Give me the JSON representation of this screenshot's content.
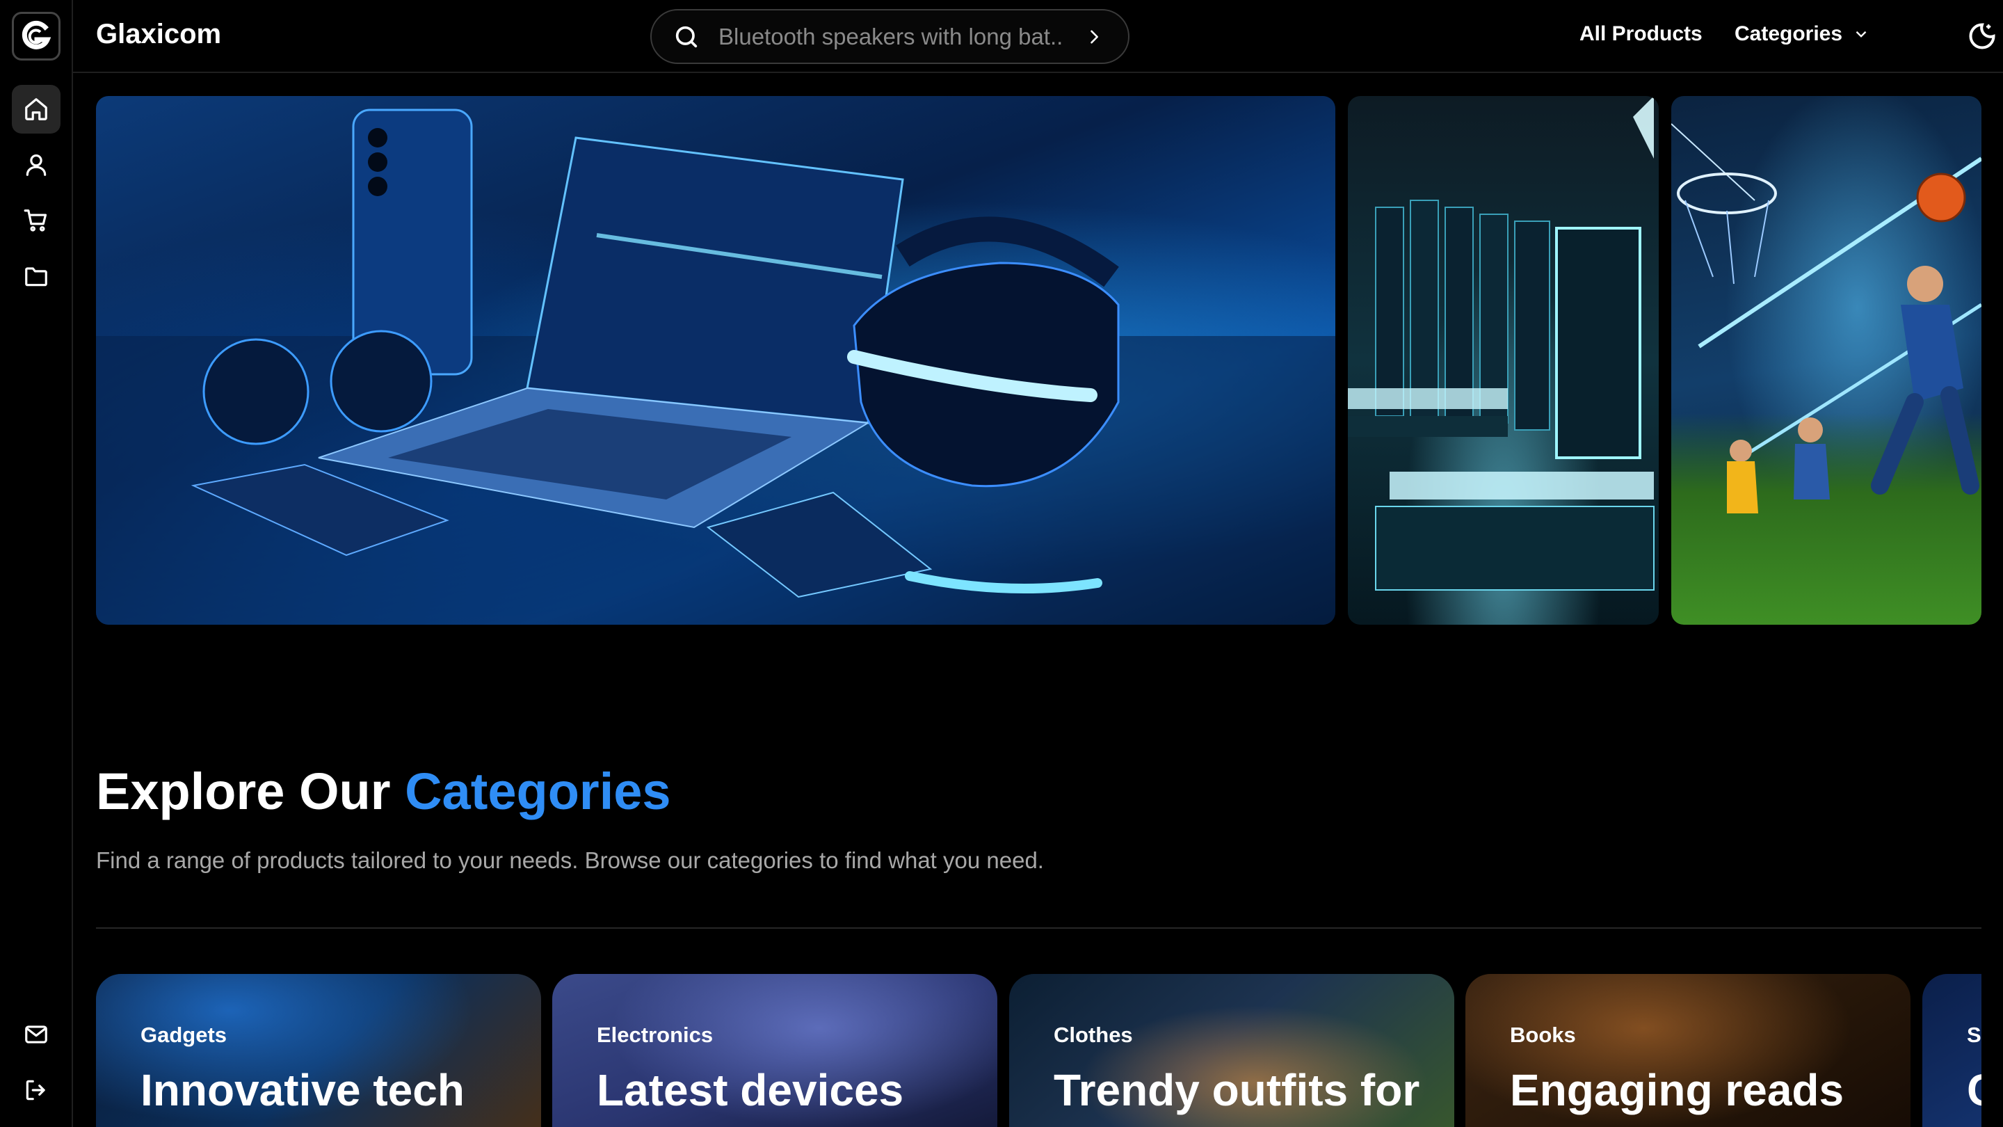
{
  "app": {
    "brand": "Glaxicom"
  },
  "search": {
    "placeholder": "Bluetooth speakers with long bat.."
  },
  "nav": {
    "all_products": "All Products",
    "categories": "Categories"
  },
  "sidebar": {
    "items": [
      {
        "name": "home",
        "icon": "home-icon",
        "active": true
      },
      {
        "name": "profile",
        "icon": "user-icon",
        "active": false
      },
      {
        "name": "cart",
        "icon": "cart-icon",
        "active": false
      },
      {
        "name": "files",
        "icon": "folder-icon",
        "active": false
      }
    ],
    "bottom": [
      {
        "name": "mail",
        "icon": "mail-icon"
      },
      {
        "name": "logout",
        "icon": "logout-icon"
      }
    ]
  },
  "hero": {
    "slides": [
      "tech-devices",
      "books",
      "sports"
    ]
  },
  "section": {
    "title_main": "Explore Our ",
    "title_accent": "Categories",
    "subtitle": "Find a range of products tailored to your needs. Browse our categories to find what you need.",
    "accent_color": "#2f8df5"
  },
  "categories": [
    {
      "label": "Gadgets",
      "headline": "Innovative tech"
    },
    {
      "label": "Electronics",
      "headline": "Latest devices"
    },
    {
      "label": "Clothes",
      "headline": "Trendy outfits for"
    },
    {
      "label": "Books",
      "headline": "Engaging reads"
    },
    {
      "label": "Sp",
      "headline": "C"
    }
  ]
}
